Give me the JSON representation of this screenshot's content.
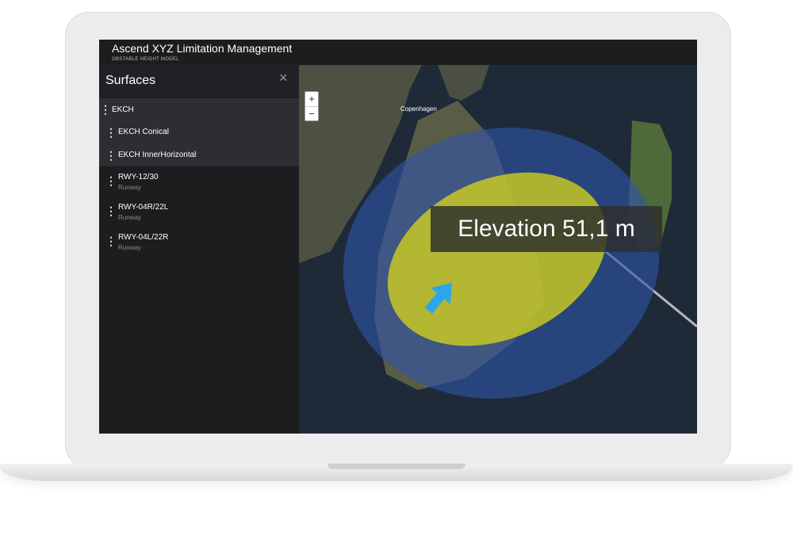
{
  "app": {
    "title": "Ascend XYZ Limitation Management",
    "subtitle": "OBSTABLE HEIGHT MODEL"
  },
  "sidebar": {
    "title": "Surfaces",
    "close_icon": "×",
    "items": [
      {
        "label": "EKCH",
        "sub": ""
      },
      {
        "label": "EKCH Conical",
        "sub": ""
      },
      {
        "label": "EKCH InnerHorizontal",
        "sub": ""
      },
      {
        "label": "RWY-12/30",
        "sub": "Runway"
      },
      {
        "label": "RWY-04R/22L",
        "sub": "Runway"
      },
      {
        "label": "RWY-04L/22R",
        "sub": "Runway"
      }
    ]
  },
  "map": {
    "zoom_in": "+",
    "zoom_out": "−",
    "place_label": "Copenhagen",
    "elevation_label": "Elevation 51,1 m",
    "colors": {
      "water": "#1e2a38",
      "land": "#4a4f3e",
      "conical_surface": "#2f54a8",
      "inner_horizontal_surface": "#d4d21c",
      "pointer_arrow": "#2aa7e8"
    }
  }
}
